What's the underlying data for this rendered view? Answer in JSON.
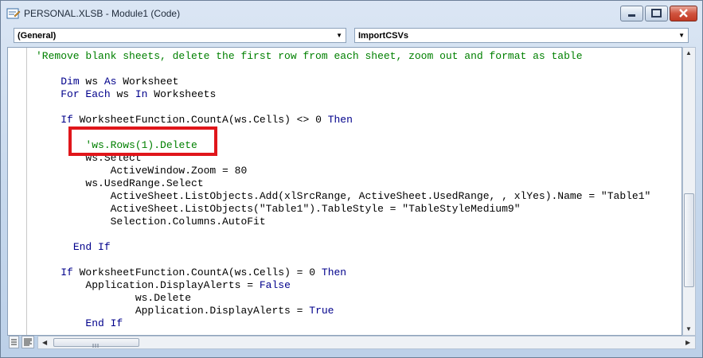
{
  "window": {
    "title": "PERSONAL.XLSB - Module1 (Code)"
  },
  "combos": {
    "object": "(General)",
    "procedure": "ImportCSVs"
  },
  "code": {
    "lines": [
      [
        {
          "t": "'Remove blank sheets, delete the first row from each sheet, zoom out and format as table",
          "c": "cm"
        }
      ],
      [],
      [
        {
          "t": "    "
        },
        {
          "t": "Dim",
          "c": "kw"
        },
        {
          "t": " ws "
        },
        {
          "t": "As",
          "c": "kw"
        },
        {
          "t": " Worksheet"
        }
      ],
      [
        {
          "t": "    "
        },
        {
          "t": "For Each",
          "c": "kw"
        },
        {
          "t": " ws "
        },
        {
          "t": "In",
          "c": "kw"
        },
        {
          "t": " Worksheets"
        }
      ],
      [],
      [
        {
          "t": "    "
        },
        {
          "t": "If",
          "c": "kw"
        },
        {
          "t": " WorksheetFunction.CountA(ws.Cells) <> 0 "
        },
        {
          "t": "Then",
          "c": "kw"
        }
      ],
      [],
      [
        {
          "t": "        "
        },
        {
          "t": "'ws.Rows(1).Delete",
          "c": "cm"
        }
      ],
      [
        {
          "t": "        ws.Select"
        }
      ],
      [
        {
          "t": "            ActiveWindow.Zoom = 80"
        }
      ],
      [
        {
          "t": "        ws.UsedRange.Select"
        }
      ],
      [
        {
          "t": "            ActiveSheet.ListObjects.Add(xlSrcRange, ActiveSheet.UsedRange, , xlYes).Name = \"Table1\""
        }
      ],
      [
        {
          "t": "            ActiveSheet.ListObjects(\"Table1\").TableStyle = \"TableStyleMedium9\""
        }
      ],
      [
        {
          "t": "            Selection.Columns.AutoFit"
        }
      ],
      [],
      [
        {
          "t": "      "
        },
        {
          "t": "End If",
          "c": "kw"
        }
      ],
      [],
      [
        {
          "t": "    "
        },
        {
          "t": "If",
          "c": "kw"
        },
        {
          "t": " WorksheetFunction.CountA(ws.Cells) = 0 "
        },
        {
          "t": "Then",
          "c": "kw"
        }
      ],
      [
        {
          "t": "        Application.DisplayAlerts = "
        },
        {
          "t": "False",
          "c": "kw"
        }
      ],
      [
        {
          "t": "                ws.Delete"
        }
      ],
      [
        {
          "t": "                Application.DisplayAlerts = "
        },
        {
          "t": "True",
          "c": "kw"
        }
      ],
      [
        {
          "t": "        "
        },
        {
          "t": "End If",
          "c": "kw"
        }
      ]
    ]
  },
  "colors": {
    "keyword": "#00008b",
    "comment": "#008000",
    "highlight_box": "#e0161b"
  },
  "icons": {
    "app": "vba-module-icon",
    "minimize": "minimize-icon",
    "maximize": "maximize-icon",
    "close": "close-icon",
    "dropdown": "chevron-down-icon",
    "scroll_up": "arrow-up-icon",
    "scroll_down": "arrow-down-icon",
    "scroll_left": "arrow-left-icon",
    "scroll_right": "arrow-right-icon",
    "grip": "grip-icon"
  }
}
